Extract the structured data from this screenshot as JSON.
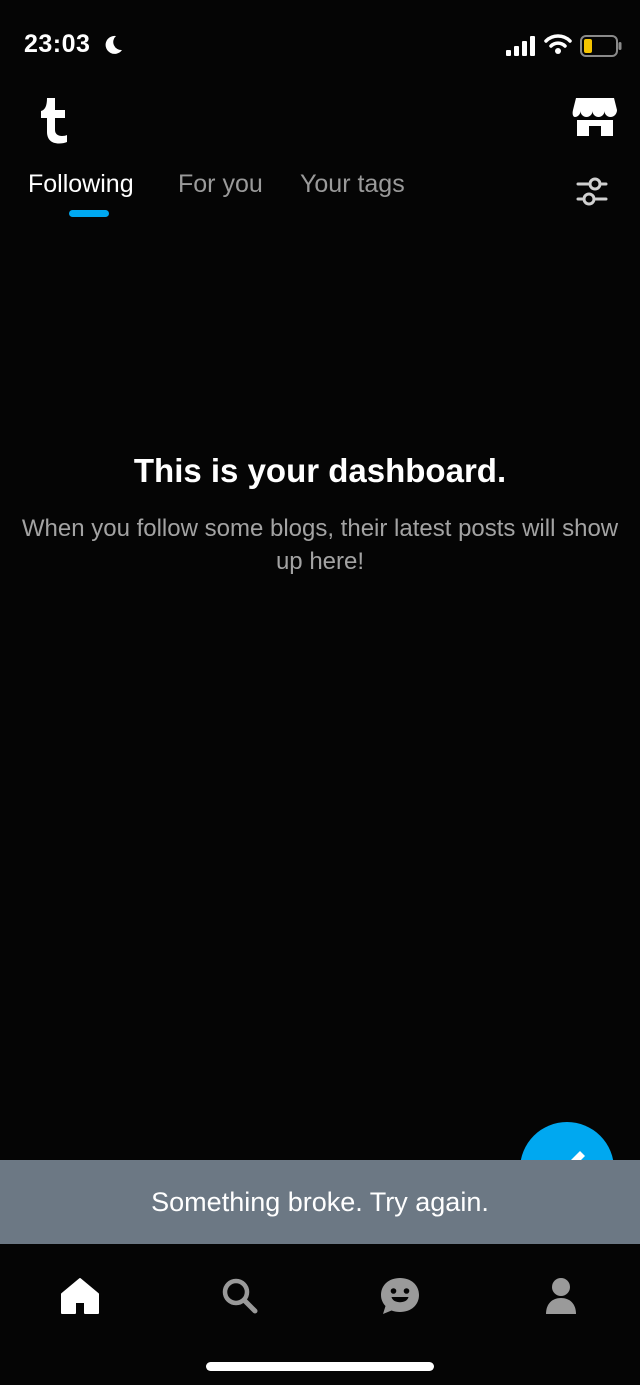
{
  "status_bar": {
    "time": "23:03",
    "icons": [
      "moon-icon",
      "signal-icon",
      "wifi-icon",
      "battery-icon"
    ]
  },
  "header": {
    "logo_icon": "tumblr-logo-icon",
    "shop_icon": "storefront-icon"
  },
  "tabs": [
    {
      "label": "Following",
      "active": true
    },
    {
      "label": "For you",
      "active": false
    },
    {
      "label": "Your tags",
      "active": false
    }
  ],
  "filter_icon": "sliders-icon",
  "empty_state": {
    "title": "This is your dashboard.",
    "body": "When you follow some blogs, their latest posts will show up here!"
  },
  "fab_icon": "pencil-icon",
  "toast": {
    "message": "Something broke. Try again."
  },
  "bottom_nav": {
    "items": [
      "home-icon",
      "search-icon",
      "activity-smiley-icon",
      "account-icon"
    ]
  },
  "colors": {
    "accent": "#00a8f0",
    "background": "#050505",
    "toast_background": "#6c7884",
    "inactive_text": "#9a9a9a",
    "battery_level": "#f5c400"
  }
}
